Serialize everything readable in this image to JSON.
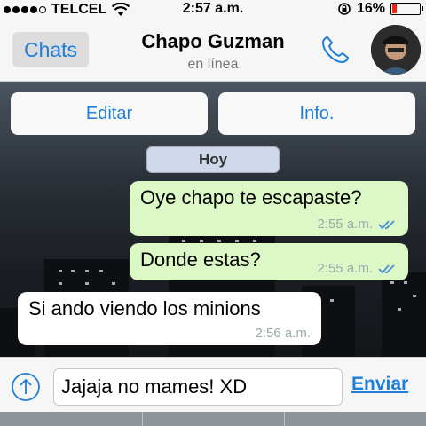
{
  "status_bar": {
    "carrier": "TELCEL",
    "time": "2:57 a.m.",
    "battery_percent": "16%",
    "battery_level": 0.16,
    "icons": [
      "signal-dots",
      "wifi-icon",
      "rotation-lock-icon",
      "battery-icon"
    ]
  },
  "nav": {
    "back_label": "Chats",
    "contact_name": "Chapo Guzman",
    "contact_status": "en línea",
    "icons": [
      "phone-icon",
      "avatar"
    ]
  },
  "actions": {
    "edit_label": "Editar",
    "info_label": "Info."
  },
  "date_divider": "Hoy",
  "messages": [
    {
      "direction": "out",
      "text": "Oye chapo te escapaste?",
      "time": "2:55 a.m.",
      "read": true
    },
    {
      "direction": "out",
      "text": "Donde estas?",
      "time": "2:55 a.m.",
      "read": true
    },
    {
      "direction": "in",
      "text": "Si ando viendo los minions",
      "time": "2:56 a.m."
    }
  ],
  "input": {
    "value": "Jajaja no mames! XD",
    "send_label": "Enviar",
    "icons": [
      "upload-icon"
    ]
  },
  "colors": {
    "accent": "#1f7ed8",
    "outgoing_bubble": "#dcf8c6",
    "incoming_bubble": "#ffffff",
    "read_ticks": "#4a8fd8",
    "battery_low": "#e21"
  }
}
